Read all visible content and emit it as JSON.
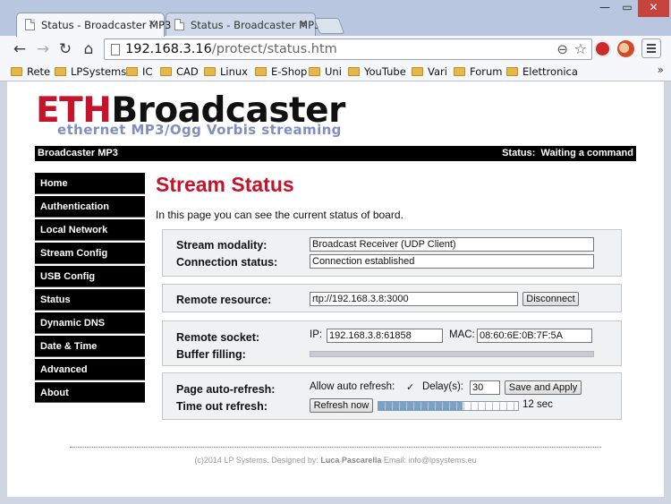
{
  "browser": {
    "tabs": [
      {
        "title": "Status - Broadcaster MP3",
        "close": "×"
      },
      {
        "title": "Status - Broadcaster MP3",
        "close": "×"
      }
    ],
    "window_controls": {
      "minimize": "—",
      "maximize": "▭",
      "close": "✕"
    },
    "nav": {
      "back": "←",
      "forward": "→",
      "reload": "↻",
      "home": "⌂"
    },
    "url": {
      "host": "192.168.3.16",
      "path": "/protect/status.htm"
    },
    "omnibox_icons": {
      "zoom": "⊖",
      "star": "☆"
    },
    "bookmarks": [
      "Rete",
      "LPSystems",
      "IC",
      "CAD",
      "Linux",
      "E-Shop",
      "Uni",
      "YouTube",
      "Vari",
      "Forum",
      "Elettronica"
    ],
    "bookmarks_more": "»",
    "colors": {
      "tabstrip": "#b8c7df",
      "toolbar": "#f5f7fb"
    }
  },
  "page": {
    "logo": {
      "eth": "ETH",
      "broadcaster": "Broadcaster",
      "subtitle": "ethernet MP3/Ogg Vorbis streaming"
    },
    "header_bar": {
      "left": "Broadcaster MP3",
      "status_label": "Status:",
      "status_value": "Waiting a command"
    },
    "menu": [
      "Home",
      "Authentication",
      "Local Network",
      "Stream Config",
      "USB Config",
      "Status",
      "Dynamic DNS",
      "Date & Time",
      "Advanced",
      "About"
    ],
    "title": "Stream Status",
    "intro": "In this page you can see the current status of board.",
    "stream": {
      "modality_label": "Stream modality:",
      "modality_value": "Broadcast Receiver (UDP Client)",
      "connection_label": "Connection status:",
      "connection_value": "Connection established"
    },
    "remote_resource": {
      "label": "Remote resource:",
      "value": "rtp://192.168.3.8:3000",
      "button": "Disconnect"
    },
    "socket": {
      "label": "Remote socket:",
      "ip_label": "IP:",
      "ip_value": "192.168.3.8:61858",
      "mac_label": "MAC:",
      "mac_value": "08:60:6E:0B:7F:5A",
      "buffer_label": "Buffer filling:",
      "buffer_fill": 0
    },
    "refresh": {
      "auto_label": "Page auto-refresh:",
      "allow_label": "Allow auto refresh:",
      "allow_checked": "✓",
      "delay_label": "Delay(s):",
      "delay_value": "30",
      "save_button": "Save and Apply",
      "timeout_label": "Time out refresh:",
      "refresh_button": "Refresh now",
      "timeout_fraction": 0.6,
      "timeout_text": "12 sec"
    },
    "footer": {
      "prefix": "(c)2014 LP Systems. Designed by:",
      "author": "Luca Pascarella",
      "email": "Email: info@lpsystems.eu"
    },
    "colors": {
      "accent_red": "#c4142b",
      "subtitle_blue": "#7f8fc0",
      "menu_bg": "#000000",
      "progress_fill": "#7aa0c7"
    }
  }
}
